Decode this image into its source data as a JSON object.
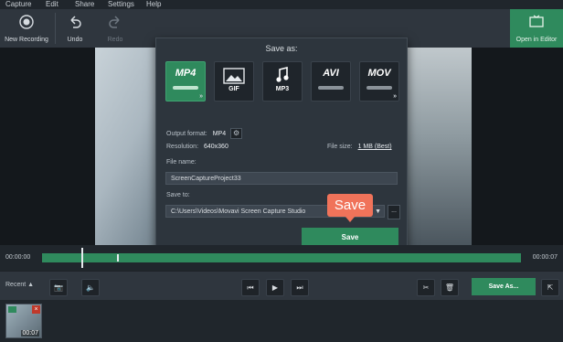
{
  "menu": [
    "Capture",
    "Edit",
    "Share",
    "Settings",
    "Help"
  ],
  "toolbar": {
    "new_recording": "New Recording",
    "undo": "Undo",
    "redo": "Redo",
    "open_in_editor": "Open in Editor"
  },
  "dialog": {
    "title": "Save as:",
    "formats": [
      {
        "label": "MP4",
        "selected": true
      },
      {
        "label": "GIF",
        "selected": false
      },
      {
        "label": "MP3",
        "selected": false
      },
      {
        "label": "AVI",
        "selected": false
      },
      {
        "label": "MOV",
        "selected": false
      }
    ],
    "output_format_label": "Output format:",
    "output_format_value": "MP4",
    "resolution_label": "Resolution:",
    "resolution_value": "640x360",
    "file_size_label": "File size:",
    "file_size_value": "1 MB (Best)",
    "file_name_label": "File name:",
    "file_name_value": "ScreenCaptureProject33",
    "save_to_label": "Save to:",
    "save_to_value": "C:\\Users\\Videos\\Movavi Screen Capture Studio",
    "browse_label": "...",
    "save_button": "Save"
  },
  "callout": "Save",
  "timeline": {
    "start_time": "00:00:00",
    "end_time": "00:00:07"
  },
  "bottombar": {
    "recent_label": "Recent",
    "save_as_label": "Save As..."
  },
  "tray": {
    "thumb_time": "00:07"
  },
  "colors": {
    "accent": "#2f8a5d",
    "callout": "#f0735a"
  }
}
